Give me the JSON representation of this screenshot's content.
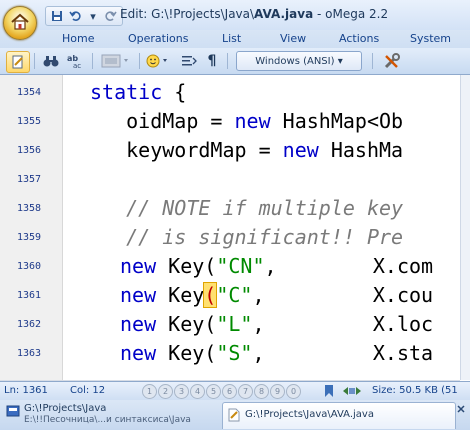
{
  "window": {
    "title_prefix": "Edit: ",
    "title_path": "G:\\!Projects\\Java\\",
    "title_file": "AVA.java",
    "title_suffix": " - oMega 2.2"
  },
  "ribbon_tabs": [
    "Home",
    "Operations",
    "List",
    "View",
    "Actions",
    "System"
  ],
  "toolbar": {
    "encoding": "Windows (ANSI)",
    "encoding_arrow": "▾",
    "pilcrow": "¶",
    "dropdown_arrow": "▾"
  },
  "editor": {
    "line_numbers": [
      "1354",
      "1355",
      "1356",
      "1357",
      "1358",
      "1359",
      "1360",
      "1361",
      "1362",
      "1363"
    ],
    "lines": {
      "l1354_kw": "static",
      "l1354_rest": " {",
      "l1355_a": "   oidMap = ",
      "l1355_kw": "new",
      "l1355_b": " HashMap<Ob",
      "l1356_a": "   keywordMap = ",
      "l1356_kw": "new",
      "l1356_b": " HashMa",
      "l1358": "   // NOTE if multiple key",
      "l1359": "   // is significant!! Pre",
      "l1360_kw": "new",
      "l1360_a": " Key(",
      "l1360_str": "\"CN\"",
      "l1360_b": ",        X.com",
      "l1361_kw": "new",
      "l1361_a": " Key",
      "l1361_paren": "(",
      "l1361_str": "\"C\"",
      "l1361_b": ",         X.cou",
      "l1362_kw": "new",
      "l1362_a": " Key(",
      "l1362_str": "\"L\"",
      "l1362_b": ",         X.loc",
      "l1363_kw": "new",
      "l1363_a": " Key(",
      "l1363_str": "\"S\"",
      "l1363_b": ",         X.sta"
    }
  },
  "status": {
    "ln_label": "Ln: 1361",
    "col_label": "Col: 12",
    "bookmarks": [
      "1",
      "2",
      "3",
      "4",
      "5",
      "6",
      "7",
      "8",
      "9",
      "0"
    ],
    "size_label": "Size: 50.5 KB (51"
  },
  "doc_tabs": [
    {
      "line1": "G:\\!Projects\\Java",
      "line2": "E:\\!!Песочница\\...и синтаксиса\\Java"
    },
    {
      "line1": "G:\\!Projects\\Java\\AVA.java"
    }
  ],
  "colors": {
    "keyword": "#0000c8",
    "string": "#008a00",
    "comment": "#7a7a7a",
    "line_number": "#1e3a8a",
    "brace_highlight": "#ffe070"
  },
  "icons": [
    "app-orb-home-icon",
    "save-icon",
    "undo-icon",
    "redo-icon",
    "new-document-icon",
    "binoculars-search-icon",
    "replace-icon",
    "screen-icon",
    "smiley-icon",
    "list-icon",
    "pilcrow-icon",
    "settings-tools-icon",
    "bookmark-icon",
    "nav-arrows-icon",
    "document-icon",
    "close-icon"
  ]
}
